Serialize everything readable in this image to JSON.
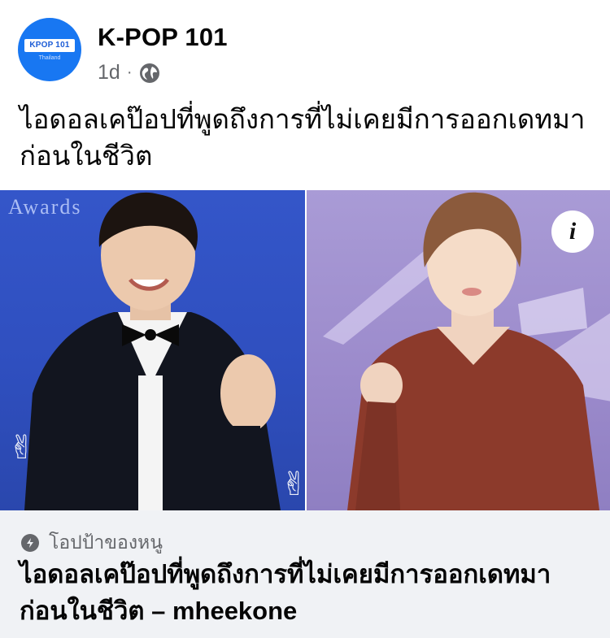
{
  "post": {
    "page_name": "K-POP 101",
    "timestamp": "1d",
    "separator": "·",
    "avatar_badge": "KPOP 101",
    "avatar_sub": "Thailand",
    "text_line1": "ไอดอลเคป๊อปที่พูดถึงการที่ไม่เคยมีการออกเดทมา",
    "text_line2": "ก่อนในชีวิต"
  },
  "media": {
    "photo_left_caption": "Awards",
    "info_label": "i"
  },
  "link": {
    "domain": "โอปป้าของหนู",
    "title_line1": "ไอดอลเคป๊อปที่พูดถึงการที่ไม่เคยมีการออกเดทมา",
    "title_line2": "ก่อนในชีวิต – mheekone"
  },
  "icons": {
    "globe": "globe-icon",
    "info": "info-icon",
    "bolt": "bolt-icon"
  },
  "colors": {
    "accent": "#1877f2",
    "meta_text": "#65676b",
    "card_bg": "#f0f2f5"
  }
}
